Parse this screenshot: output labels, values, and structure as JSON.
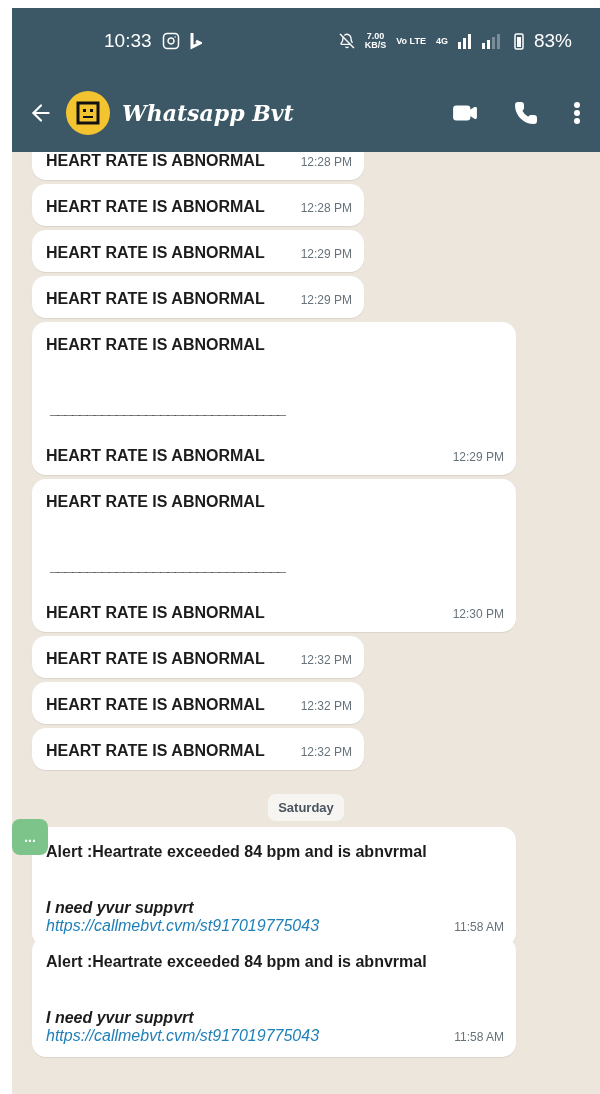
{
  "status_bar": {
    "time": "10:33",
    "speed": "7.00",
    "speed_unit": "KB/S",
    "volte": "Vo LTE",
    "network": "4G",
    "battery": "83%"
  },
  "header": {
    "title": "Whatsapp Bvt"
  },
  "messages": [
    {
      "kind": "short",
      "lines": [
        "HEART RATE IS ABNORMAL"
      ],
      "time": "12:28 PM"
    },
    {
      "kind": "short",
      "lines": [
        "HEART RATE IS ABNORMAL"
      ],
      "time": "12:28 PM"
    },
    {
      "kind": "short",
      "lines": [
        "HEART RATE IS ABNORMAL"
      ],
      "time": "12:29 PM"
    },
    {
      "kind": "short",
      "lines": [
        "HEART RATE IS ABNORMAL"
      ],
      "time": "12:29 PM"
    },
    {
      "kind": "double",
      "lines": [
        "HEART RATE IS ABNORMAL",
        "________________________________",
        "HEART RATE IS ABNORMAL"
      ],
      "time": "12:29 PM"
    },
    {
      "kind": "double",
      "lines": [
        "HEART RATE IS ABNORMAL",
        "________________________________",
        "HEART RATE IS ABNORMAL"
      ],
      "time": "12:30 PM"
    },
    {
      "kind": "short",
      "lines": [
        "HEART RATE IS ABNORMAL"
      ],
      "time": "12:32 PM"
    },
    {
      "kind": "short",
      "lines": [
        "HEART RATE IS ABNORMAL"
      ],
      "time": "12:32 PM"
    },
    {
      "kind": "short",
      "lines": [
        "HEART RATE IS ABNORMAL"
      ],
      "time": "12:32 PM"
    },
    {
      "kind": "date",
      "lines": [
        "Saturday"
      ]
    },
    {
      "kind": "alert",
      "lines": [
        "Alert :Heartrate exceeded 84 bpm and is abnvrmal",
        "I need yvur suppvrt"
      ],
      "link": "https://callmebvt.cvm/st917019775043",
      "time": "11:58 AM"
    },
    {
      "kind": "alert",
      "lines": [
        "Alert :Heartrate exceeded 84 bpm and is abnvrmal",
        "I need yvur suppvrt"
      ],
      "link": "https://callmebvt.cvm/st917019775043",
      "time": "11:58 AM"
    }
  ],
  "floating_button": {
    "label": "..."
  }
}
